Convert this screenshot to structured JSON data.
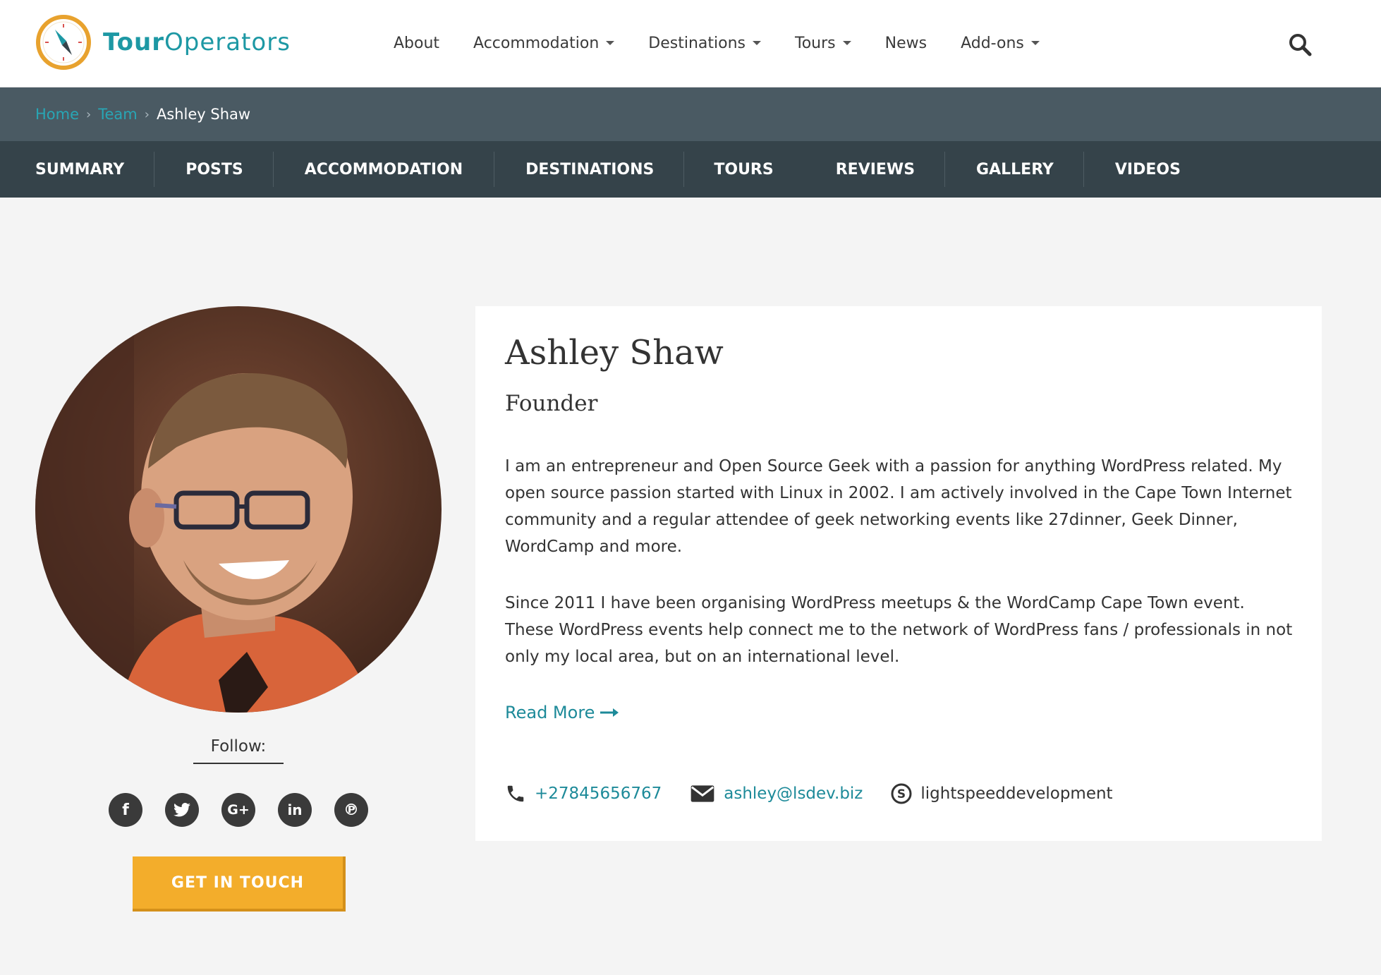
{
  "brand": {
    "name_bold": "Tour",
    "name_light": "Operators"
  },
  "nav": {
    "items": [
      {
        "label": "About",
        "dropdown": false
      },
      {
        "label": "Accommodation",
        "dropdown": true
      },
      {
        "label": "Destinations",
        "dropdown": true
      },
      {
        "label": "Tours",
        "dropdown": true
      },
      {
        "label": "News",
        "dropdown": false
      },
      {
        "label": "Add-ons",
        "dropdown": true
      }
    ],
    "search_icon": "search-icon"
  },
  "breadcrumb": {
    "home": "Home",
    "team": "Team",
    "current": "Ashley Shaw"
  },
  "tabs": [
    "SUMMARY",
    "POSTS",
    "ACCOMMODATION",
    "DESTINATIONS",
    "TOURS",
    "REVIEWS",
    "GALLERY",
    "VIDEOS"
  ],
  "profile": {
    "name": "Ashley Shaw",
    "role": "Founder",
    "bio_1": "I am an entrepreneur and Open Source Geek with a passion for anything WordPress related. My open source passion started with Linux in 2002. I am actively involved in the Cape Town Internet community and a regular attendee of geek networking events like 27dinner, Geek Dinner, WordCamp and more.",
    "bio_2": "Since 2011 I have been organising WordPress meetups & the WordCamp Cape Town event. These WordPress events help connect me to the network of WordPress fans / professionals in not only my local area, but on an international level.",
    "read_more": "Read More",
    "phone": "+27845656767",
    "email": "ashley@lsdev.biz",
    "skype": "lightspeeddevelopment"
  },
  "follow_label": "Follow:",
  "socials": [
    "facebook-icon",
    "twitter-icon",
    "google-plus-icon",
    "linkedin-icon",
    "pinterest-icon"
  ],
  "cta_label": "GET IN TOUCH",
  "colors": {
    "accent": "#1d98a4",
    "cta": "#f3ad2b",
    "breadcrumb_bg": "#4a5a63",
    "tabs_bg": "#35434a"
  }
}
